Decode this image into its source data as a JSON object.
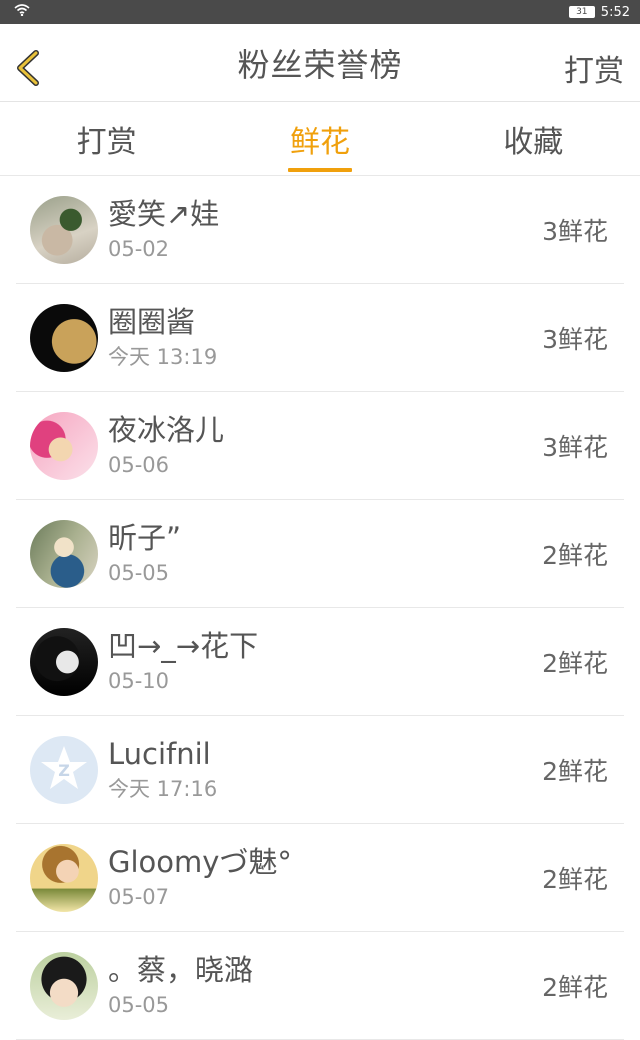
{
  "status_bar": {
    "battery": "31",
    "time": "5:52",
    "icons": [
      "wifi-icon",
      "battery-icon"
    ]
  },
  "header": {
    "back_icon": "chevron-left-icon",
    "title": "粉丝荣誉榜",
    "action_label": "打赏"
  },
  "tabs": [
    {
      "label": "打赏",
      "active": false
    },
    {
      "label": "鲜花",
      "active": true
    },
    {
      "label": "收藏",
      "active": false
    }
  ],
  "colors": {
    "accent": "#f0a00c",
    "text": "#555555",
    "subtext": "#999999",
    "divider": "#e8e8e8",
    "status_bar": "#4a4a4a"
  },
  "fans": [
    {
      "name": "愛笑↗娃",
      "date": "05-02",
      "count": "3鲜花"
    },
    {
      "name": "圈圈酱",
      "date": "今天 13:19",
      "count": "3鲜花"
    },
    {
      "name": "夜冰洛儿",
      "date": "05-06",
      "count": "3鲜花"
    },
    {
      "name": "昕子”",
      "date": "05-05",
      "count": "2鲜花"
    },
    {
      "name": "凹→_→花下",
      "date": "05-10",
      "count": "2鲜花"
    },
    {
      "name": "Lucifnil",
      "date": "今天 17:16",
      "count": "2鲜花"
    },
    {
      "name": "Gloomyづ魅°",
      "date": "05-07",
      "count": "2鲜花"
    },
    {
      "name": "。蔡，晓潞",
      "date": "05-05",
      "count": "2鲜花"
    }
  ]
}
